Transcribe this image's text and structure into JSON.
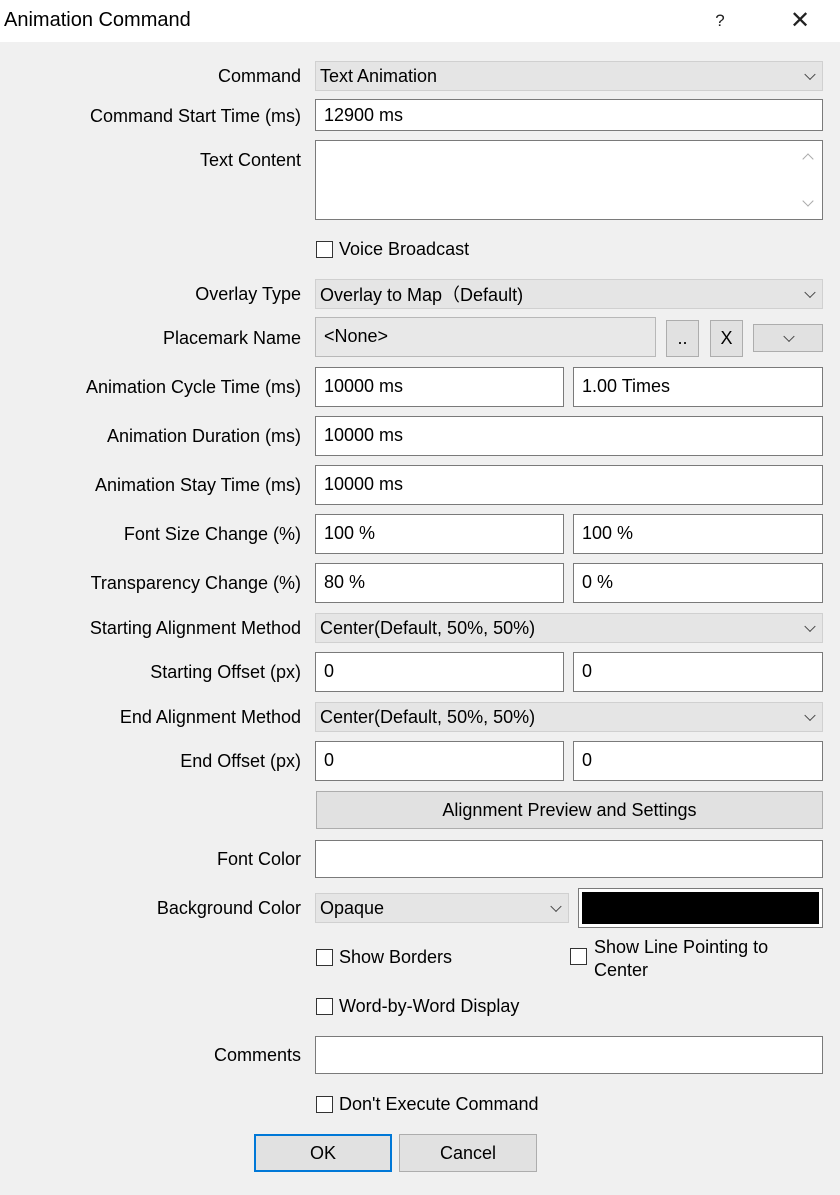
{
  "window": {
    "title": "Animation Command",
    "help_label": "?",
    "close_label": "✕"
  },
  "command": {
    "label": "Command",
    "value": "Text Animation"
  },
  "start_time": {
    "label": "Command Start Time (ms)",
    "value": "12900 ms"
  },
  "text_content": {
    "label": "Text Content",
    "value": ""
  },
  "voice_broadcast": {
    "label": "Voice Broadcast",
    "checked": false
  },
  "overlay_type": {
    "label": "Overlay Type",
    "value": "Overlay to Map（Default)"
  },
  "placemark": {
    "label": "Placemark Name",
    "value": "<None>",
    "browse_label": "..",
    "clear_label": "X"
  },
  "cycle_time": {
    "label": "Animation Cycle Time (ms)",
    "value": "10000 ms",
    "times": "1.00 Times"
  },
  "duration": {
    "label": "Animation Duration (ms)",
    "value": "10000 ms"
  },
  "stay_time": {
    "label": "Animation Stay Time (ms)",
    "value": "10000 ms"
  },
  "font_size_change": {
    "label": "Font Size Change (%)",
    "start": "100 %",
    "end": "100 %"
  },
  "transparency_change": {
    "label": "Transparency Change (%)",
    "start": "80 %",
    "end": "0 %"
  },
  "start_alignment": {
    "label": "Starting Alignment Method",
    "value": "Center(Default, 50%, 50%)"
  },
  "start_offset": {
    "label": "Starting Offset (px)",
    "x": "0",
    "y": "0"
  },
  "end_alignment": {
    "label": "End Alignment Method",
    "value": "Center(Default, 50%, 50%)"
  },
  "end_offset": {
    "label": "End Offset (px)",
    "x": "0",
    "y": "0"
  },
  "alignment_preview_label": "Alignment Preview and Settings",
  "font_color": {
    "label": "Font Color",
    "color": "#ffffff"
  },
  "background_color": {
    "label": "Background Color",
    "mode": "Opaque",
    "color": "#000000"
  },
  "show_borders": {
    "label": "Show Borders",
    "checked": false
  },
  "show_line": {
    "label_line1": "Show Line Pointing to",
    "label_line2": "Center",
    "checked": false
  },
  "word_by_word": {
    "label": "Word-by-Word Display",
    "checked": false
  },
  "comments": {
    "label": "Comments",
    "value": ""
  },
  "dont_execute": {
    "label": "Don't Execute Command",
    "checked": false
  },
  "ok_label": "OK",
  "cancel_label": "Cancel",
  "colors": {
    "accent": "#0078d7",
    "dialog_bg": "#f0f0f0"
  }
}
